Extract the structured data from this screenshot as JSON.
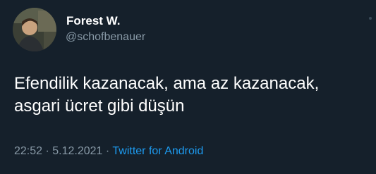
{
  "author": {
    "name": "Forest W.",
    "handle": "@schofbenauer",
    "avatar_icon": "profile-photo"
  },
  "tweet": {
    "text": "Efendilik kazanacak, ama az kazanacak,\nasgari ücret gibi düşün"
  },
  "meta": {
    "time": "22:52",
    "separator": " · ",
    "date": "5.12.2021",
    "source": "Twitter for Android"
  },
  "colors": {
    "background": "#15202b",
    "text": "#ffffff",
    "secondary": "#8899a6",
    "accent": "#1d9bf0"
  }
}
